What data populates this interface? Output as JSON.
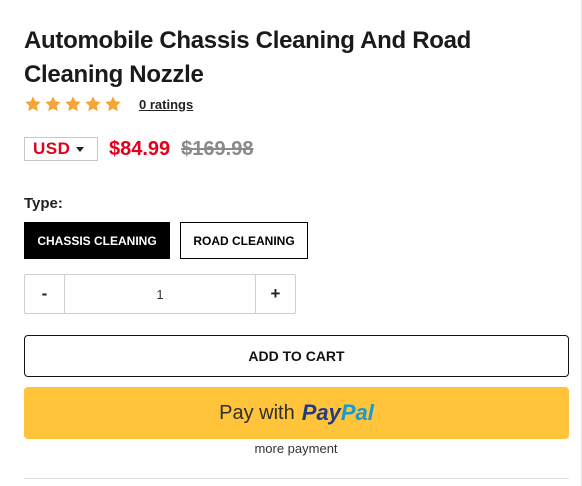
{
  "product": {
    "title": "Automobile Chassis Cleaning And Road Cleaning Nozzle",
    "rating": {
      "stars": 5,
      "ratings_text": "0 ratings",
      "star_color": "#f7a437"
    },
    "currency": {
      "selected": "USD"
    },
    "price": {
      "sale": "$84.99",
      "compare_at": "$169.98",
      "sale_color": "#e4001b"
    },
    "type": {
      "label": "Type:",
      "options": [
        {
          "label": "CHASSIS CLEANING",
          "selected": true
        },
        {
          "label": "ROAD CLEANING",
          "selected": false
        }
      ]
    },
    "quantity": {
      "decrement": "-",
      "value": "1",
      "increment": "+"
    }
  },
  "actions": {
    "add_to_cart": "ADD TO CART",
    "paypal": {
      "prefix": "Pay with",
      "brand_pay": "Pay",
      "brand_pal": "Pal",
      "bg_color": "#ffc439"
    },
    "more_payment": "more payment"
  },
  "icons": {
    "star": "star-icon",
    "caret": "caret-down-icon"
  }
}
